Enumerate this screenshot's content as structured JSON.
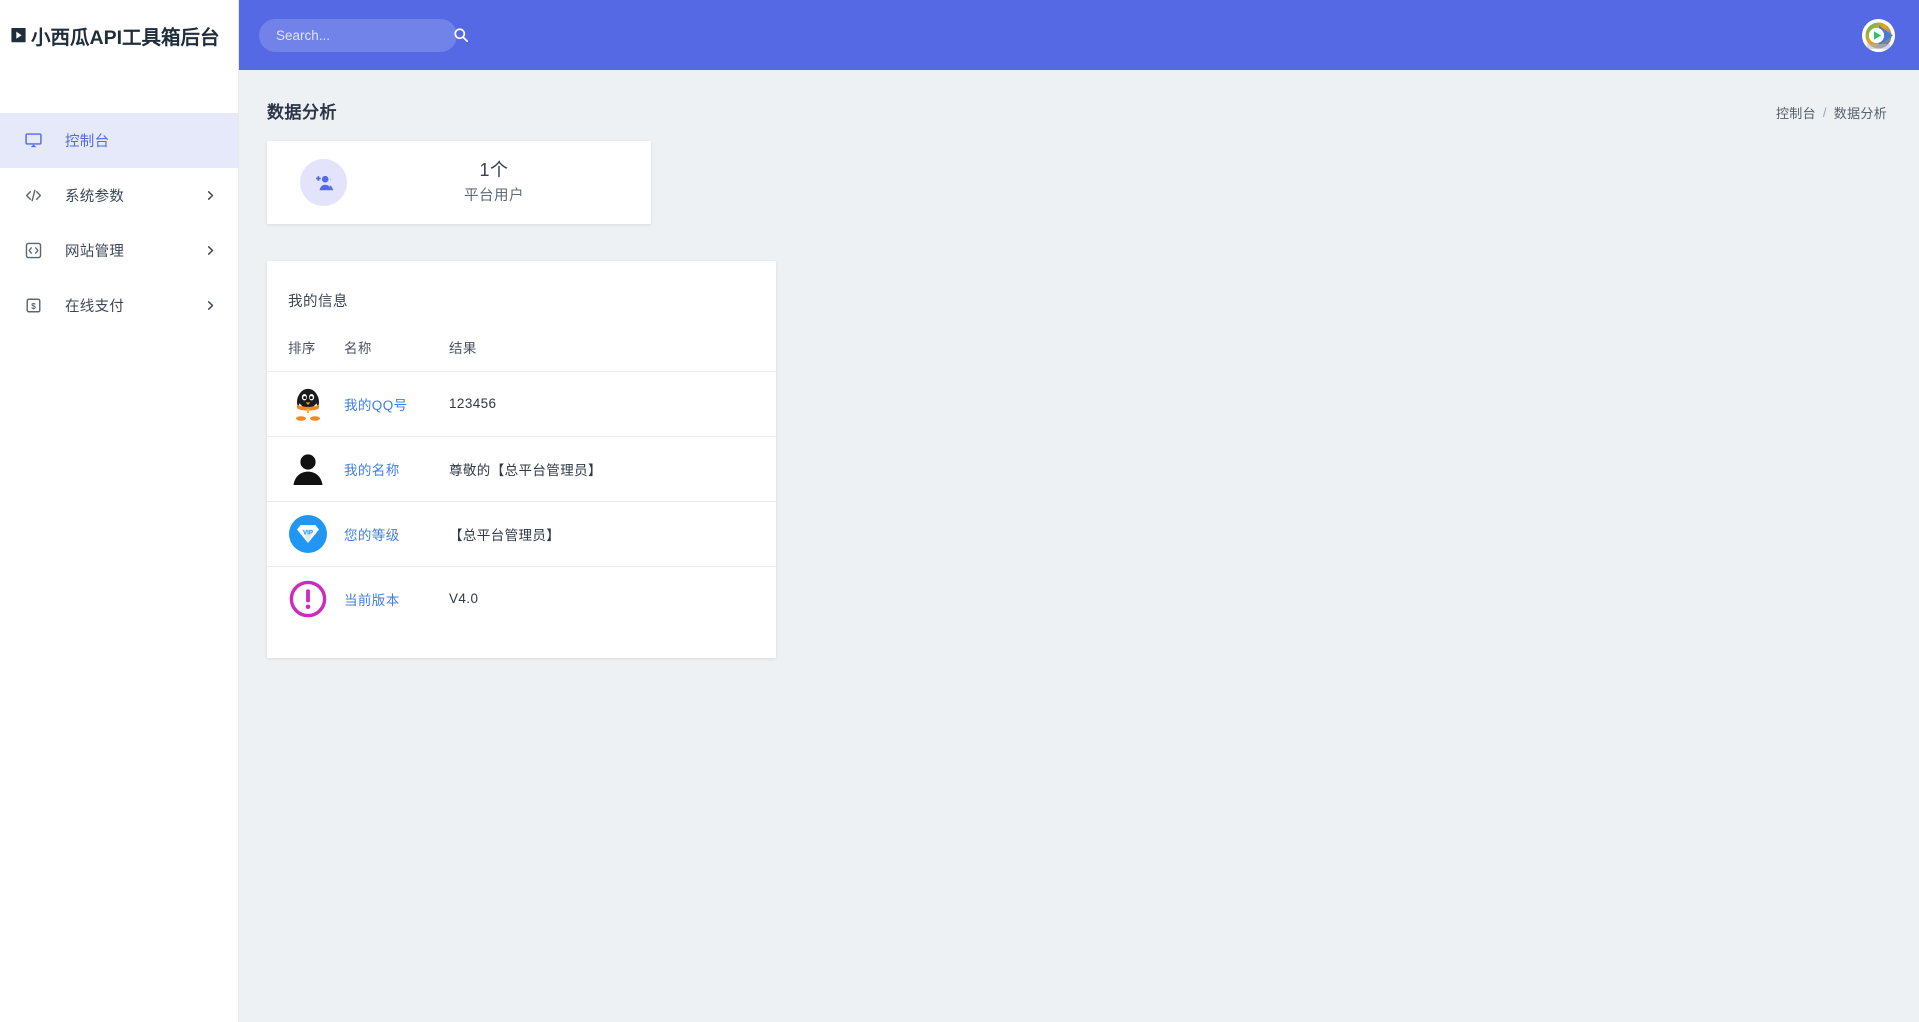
{
  "brand": {
    "logo_icon": "play-box-icon",
    "title": "小西瓜API工具箱后台"
  },
  "sidebar": {
    "items": [
      {
        "label": "控制台",
        "icon": "monitor-icon",
        "active": true,
        "has_arrow": false
      },
      {
        "label": "系统参数",
        "icon": "code-icon",
        "active": false,
        "has_arrow": true
      },
      {
        "label": "网站管理",
        "icon": "code-box-icon",
        "active": false,
        "has_arrow": true
      },
      {
        "label": "在线支付",
        "icon": "money-box-icon",
        "active": false,
        "has_arrow": true
      }
    ]
  },
  "topbar": {
    "search": {
      "placeholder": "Search...",
      "value": "",
      "icon": "search-icon"
    },
    "avatar": {
      "icon": "play-logo-avatar"
    },
    "background_color": "#5569e4"
  },
  "page": {
    "title": "数据分析",
    "breadcrumb": {
      "root": "控制台",
      "separator": "/",
      "current": "数据分析"
    }
  },
  "stat_cards": [
    {
      "icon": "add-user-icon",
      "value": "1个",
      "label": "平台用户",
      "icon_bg": "#e3e4fb",
      "icon_color": "#5569e4"
    }
  ],
  "info_panel": {
    "title": "我的信息",
    "columns": [
      "排序",
      "名称",
      "结果"
    ],
    "rows": [
      {
        "icon": "qq-penguin-icon",
        "name": "我的QQ号",
        "result": "123456"
      },
      {
        "icon": "person-avatar-icon",
        "name": "我的名称",
        "result": "尊敬的【总平台管理员】"
      },
      {
        "icon": "vip-diamond-icon",
        "name": "您的等级",
        "result": "【总平台管理员】"
      },
      {
        "icon": "exclamation-circle-icon",
        "name": "当前版本",
        "result": "V4.0"
      }
    ]
  },
  "theme": {
    "accent": "#5569e4",
    "active_nav_bg": "#e5e9fa",
    "page_bg": "#eef1f3",
    "link_color": "#3f7fe0",
    "vip_blue": "#2196f3",
    "version_magenta": "#cc2bbb"
  }
}
